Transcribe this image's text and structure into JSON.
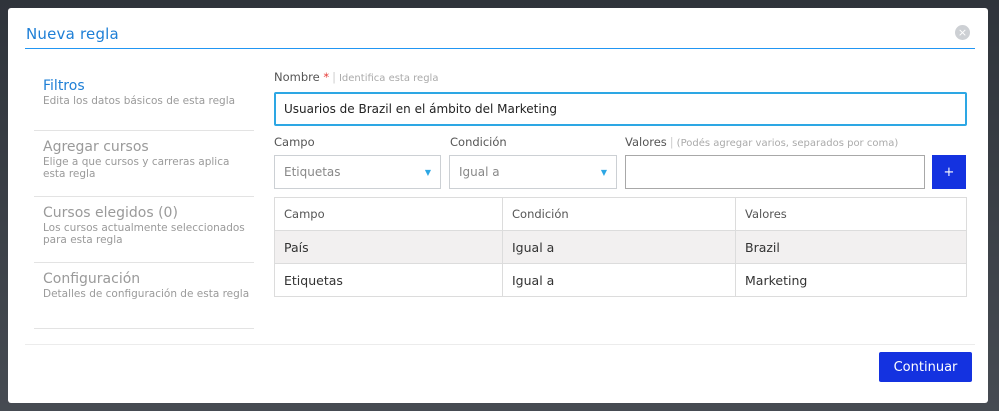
{
  "modal": {
    "title": "Nueva regla",
    "close_icon": "close-icon",
    "close_glyph": "×"
  },
  "sidebar": {
    "items": [
      {
        "title": "Filtros",
        "desc": "Edita los datos básicos de esta regla",
        "active": true
      },
      {
        "title": "Agregar cursos",
        "desc": "Elige a que cursos y carreras aplica esta regla",
        "active": false
      },
      {
        "title": "Cursos elegidos (0)",
        "desc": "Los cursos actualmente seleccionados para esta regla",
        "active": false
      },
      {
        "title": "Configuración",
        "desc": "Detalles de configuración de esta regla",
        "active": false
      }
    ]
  },
  "form": {
    "name_label": "Nombre",
    "required_mark": "*",
    "name_hint": "Identifica esta regla",
    "name_value": "Usuarios de Brazil en el ámbito del Marketing",
    "campo_label": "Campo",
    "condicion_label": "Condición",
    "valores_label": "Valores",
    "valores_hint": "(Podés agregar varios, separados por coma)",
    "campo_selected": "Etiquetas",
    "condicion_selected": "Igual a",
    "valores_value": "",
    "add_label": "+"
  },
  "table": {
    "headers": [
      "Campo",
      "Condición",
      "Valores"
    ],
    "rows": [
      [
        "País",
        "Igual a",
        "Brazil"
      ],
      [
        "Etiquetas",
        "Igual a",
        "Marketing"
      ]
    ]
  },
  "footer": {
    "continue_label": "Continuar"
  },
  "colors": {
    "accent": "#1e7fd6",
    "primary_button": "#1432e0",
    "input_focus": "#2da7e4"
  }
}
